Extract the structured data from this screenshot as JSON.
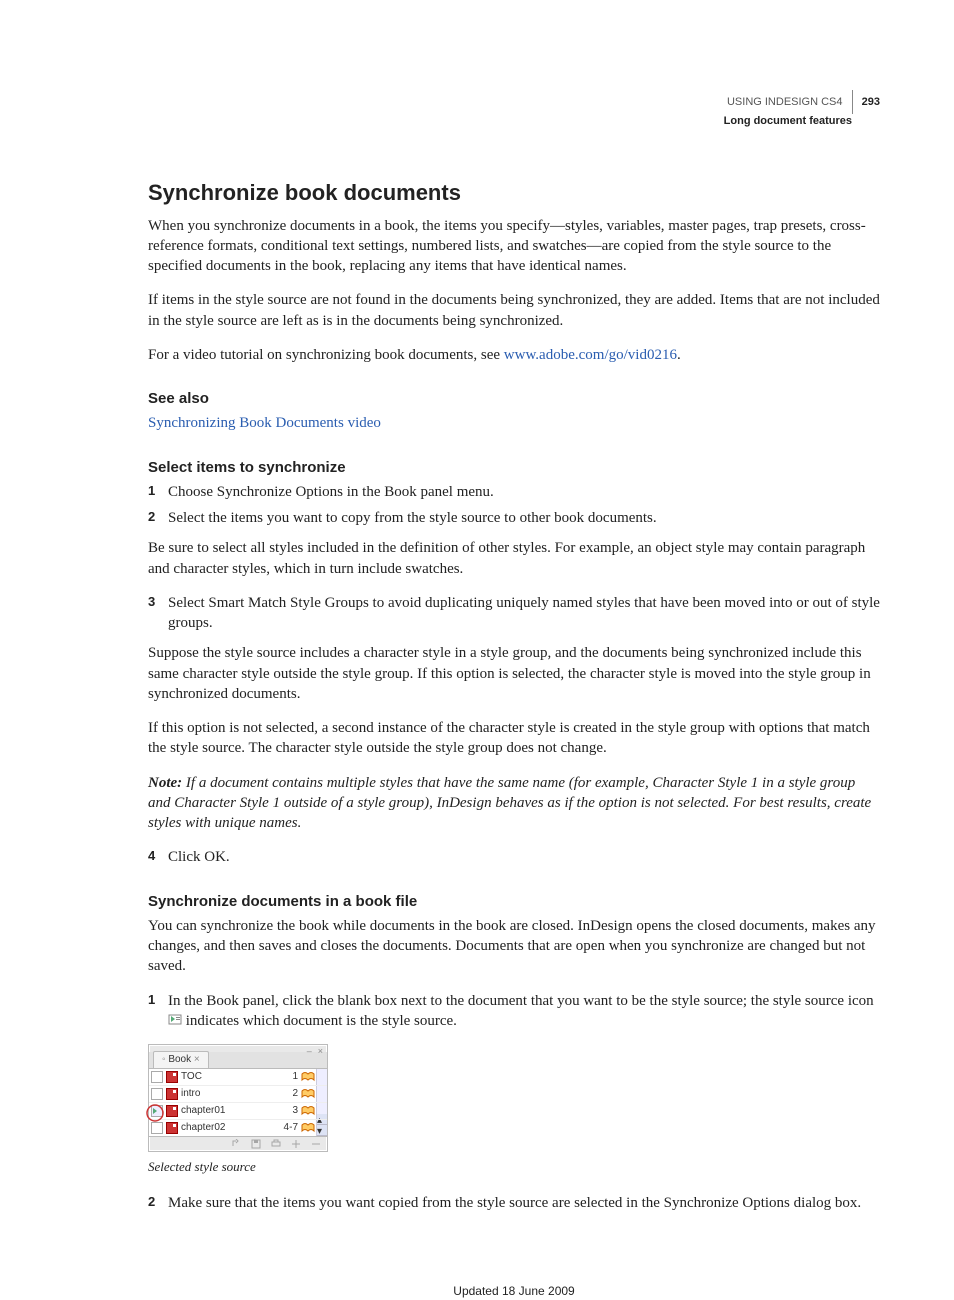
{
  "running_head": {
    "product": "USING INDESIGN CS4",
    "section": "Long document features",
    "page_number": "293"
  },
  "h1": "Synchronize book documents",
  "intro_p1": "When you synchronize documents in a book, the items you specify—styles, variables, master pages, trap presets, cross-reference formats, conditional text settings, numbered lists, and swatches—are copied from the style source to the specified documents in the book, replacing any items that have identical names.",
  "intro_p2": "If items in the style source are not found in the documents being synchronized, they are added. Items that are not included in the style source are left as is in the documents being synchronized.",
  "intro_p3_pre": "For a video tutorial on synchronizing book documents, see ",
  "intro_p3_link": "www.adobe.com/go/vid0216",
  "intro_p3_post": ".",
  "see_also_h": "See also",
  "see_also_link": "Synchronizing Book Documents video",
  "sub1_h": "Select items to synchronize",
  "sub1_step1": "Choose Synchronize Options in the Book panel menu.",
  "sub1_step2": "Select the items you want to copy from the style source to other book documents.",
  "sub1_p_after2": "Be sure to select all styles included in the definition of other styles. For example, an object style may contain paragraph and character styles, which in turn include swatches.",
  "sub1_step3": "Select Smart Match Style Groups to avoid duplicating uniquely named styles that have been moved into or out of style groups.",
  "sub1_p_after3a": "Suppose the style source includes a character style in a style group, and the documents being synchronized include this same character style outside the style group. If this option is selected, the character style is moved into the style group in synchronized documents.",
  "sub1_p_after3b": "If this option is not selected, a second instance of the character style is created in the style group with options that match the style source. The character style outside the style group does not change.",
  "note_label": "Note:",
  "note_body": " If a document contains multiple styles that have the same name (for example, Character Style 1 in a style group and Character Style 1 outside of a style group), InDesign behaves as if the option is not selected. For best results, create styles with unique names.",
  "sub1_step4": "Click OK.",
  "sub2_h": "Synchronize documents in a book file",
  "sub2_p1": "You can synchronize the book while documents in the book are closed. InDesign opens the closed documents, makes any changes, and then saves and closes the documents. Documents that are open when you synchronize are changed but not saved.",
  "sub2_step1_pre": "In the Book panel, click the blank box next to the document that you want to be the style source; the style source icon ",
  "sub2_step1_post": " indicates which document is the style source.",
  "figure": {
    "panel_tab": "Book",
    "rows": [
      {
        "name": "TOC",
        "pages": "1",
        "style_source": false
      },
      {
        "name": "intro",
        "pages": "2",
        "style_source": false
      },
      {
        "name": "chapter01",
        "pages": "3",
        "style_source": true
      },
      {
        "name": "chapter02",
        "pages": "4-7",
        "style_source": false
      }
    ],
    "caption": "Selected style source"
  },
  "sub2_step2": "Make sure that the items you want copied from the style source are selected in the Synchronize Options dialog box.",
  "updated": "Updated 18 June 2009"
}
